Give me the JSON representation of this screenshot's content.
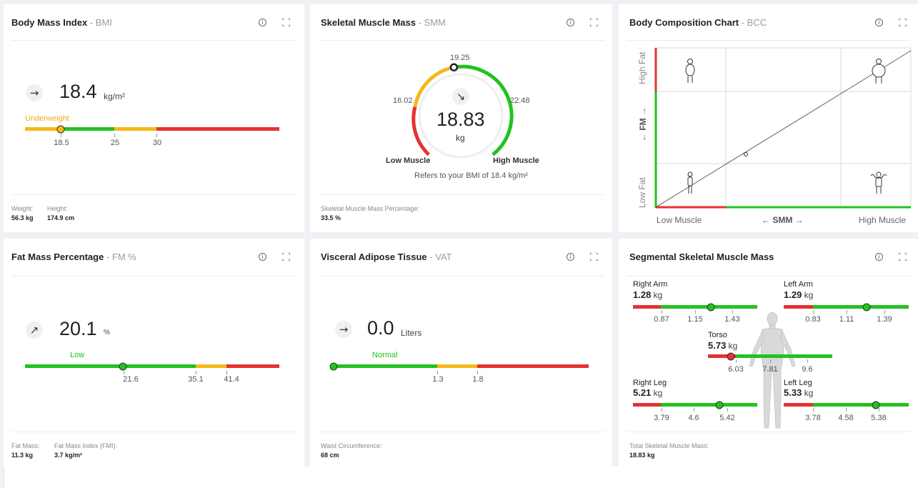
{
  "colors": {
    "green": "#22c21f",
    "red": "#e53232",
    "yellow": "#f6b817",
    "orange_text": "#f6a91b"
  },
  "bmi": {
    "title": "Body Mass Index",
    "subtitle": "- BMI",
    "trend_icon": "arrow-right-icon",
    "value": "18.4",
    "unit": "kg/m²",
    "category": "Underweight",
    "ticks": [
      "18.5",
      "25",
      "30"
    ],
    "footer": {
      "weight_label": "Weight:",
      "weight_value": "56.3 kg",
      "height_label": "Height:",
      "height_value": "174.9 cm"
    }
  },
  "smm": {
    "title": "Skeletal Muscle Mass",
    "subtitle": "- SMM",
    "trend_icon": "arrow-down-right-icon",
    "value": "18.83",
    "unit": "kg",
    "tick_top": "19.25",
    "tick_left": "16.02",
    "tick_right": "22.48",
    "label_low": "Low Muscle",
    "label_high": "High Muscle",
    "note": "Refers to your BMI of 18.4 kg/m²",
    "footer": {
      "label": "Skeletal Muscle Mass Percentage:",
      "value": "33.5 %"
    }
  },
  "bcc": {
    "title": "Body Composition Chart",
    "subtitle": "- BCC",
    "y_high": "High Fat",
    "y_axis": "← FM →",
    "y_low": "Low Fat",
    "x_low": "Low Muscle",
    "x_axis": "← SMM →",
    "x_high": "High Muscle"
  },
  "fm": {
    "title": "Fat Mass Percentage",
    "subtitle": "- FM %",
    "trend_icon": "arrow-up-right-icon",
    "value": "20.1",
    "unit": "%",
    "category": "Low",
    "ticks": [
      "21.6",
      "35.1",
      "41.4"
    ],
    "footer": {
      "fat_mass_label": "Fat Mass:",
      "fat_mass_value": "11.3 kg",
      "fmi_label": "Fat Mass Index (FMI):",
      "fmi_value": "3.7 kg/m²"
    }
  },
  "vat": {
    "title": "Visceral Adipose Tissue",
    "subtitle": "- VAT",
    "trend_icon": "arrow-right-icon",
    "value": "0.0",
    "unit": "Liters",
    "category": "Normal",
    "ticks": [
      "1.3",
      "1.8"
    ],
    "footer": {
      "label": "Waist Circumference:",
      "value": "68 cm"
    }
  },
  "ssmm": {
    "title": "Segmental Skeletal Muscle Mass",
    "unit": "kg",
    "right_arm": {
      "name": "Right Arm",
      "value": "1.28",
      "ticks": [
        "0.87",
        "1.15",
        "1.43"
      ]
    },
    "left_arm": {
      "name": "Left Arm",
      "value": "1.29",
      "ticks": [
        "0.83",
        "1.11",
        "1.39"
      ]
    },
    "torso": {
      "name": "Torso",
      "value": "5.73",
      "ticks": [
        "6.03",
        "7.81",
        "9.6"
      ]
    },
    "right_leg": {
      "name": "Right Leg",
      "value": "5.21",
      "ticks": [
        "3.79",
        "4.6",
        "5.42"
      ]
    },
    "left_leg": {
      "name": "Left Leg",
      "value": "5.33",
      "ticks": [
        "3.78",
        "4.58",
        "5.38"
      ]
    },
    "footer": {
      "label": "Total Skeletal Muscle Mass:",
      "value": "18.83 kg"
    }
  }
}
